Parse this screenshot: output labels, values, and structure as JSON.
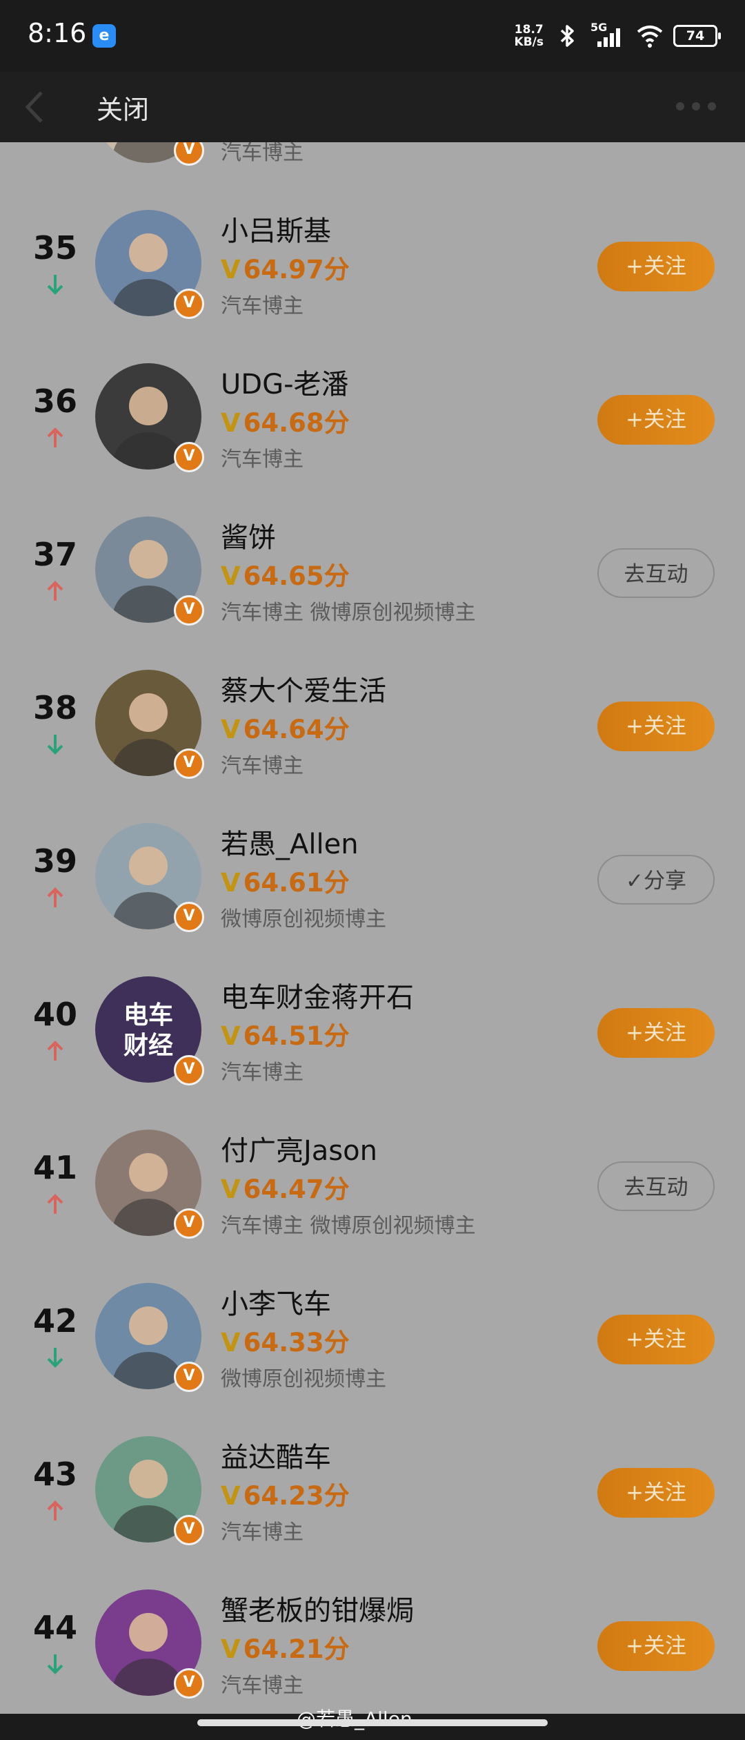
{
  "status_bar": {
    "time": "8:16",
    "app_icon_letter": "e",
    "net_speed_value": "18.7",
    "net_speed_unit": "KB/s",
    "signal_label": "5G",
    "battery": "74"
  },
  "nav": {
    "close_label": "关闭"
  },
  "rows": [
    {
      "rank": "",
      "trend": "up",
      "name": "",
      "score": "",
      "tags": "汽车博主",
      "button": "",
      "button_style": "follow",
      "avatar_color": "#c8b8a6"
    },
    {
      "rank": "35",
      "trend": "down",
      "name": "小吕斯基",
      "score": "64.97分",
      "tags": "汽车博主",
      "button": "+关注",
      "button_style": "follow",
      "avatar_color": "#6e86a6"
    },
    {
      "rank": "36",
      "trend": "up",
      "name": "UDG-老潘",
      "score": "64.68分",
      "tags": "汽车博主",
      "button": "+关注",
      "button_style": "follow",
      "avatar_color": "#3b3b3b"
    },
    {
      "rank": "37",
      "trend": "up",
      "name": "酱饼",
      "score": "64.65分",
      "tags": "汽车博主 微博原创视频博主",
      "button": "去互动",
      "button_style": "outline",
      "avatar_color": "#7a8a98"
    },
    {
      "rank": "38",
      "trend": "down",
      "name": "蔡大个爱生活",
      "score": "64.64分",
      "tags": "汽车博主",
      "button": "+关注",
      "button_style": "follow",
      "avatar_color": "#6a5a3c"
    },
    {
      "rank": "39",
      "trend": "up",
      "name": "若愚_Allen",
      "score": "64.61分",
      "tags": "微博原创视频博主",
      "button": "✓分享",
      "button_style": "outline",
      "avatar_color": "#93a3ad"
    },
    {
      "rank": "40",
      "trend": "up",
      "name": "电车财金蒋开石",
      "score": "64.51分",
      "tags": "汽车博主",
      "button": "+关注",
      "button_style": "follow",
      "avatar_color": "#3e3058",
      "avatar_text": "电车财经"
    },
    {
      "rank": "41",
      "trend": "up",
      "name": "付广亮Jason",
      "score": "64.47分",
      "tags": "汽车博主 微博原创视频博主",
      "button": "去互动",
      "button_style": "outline",
      "avatar_color": "#8a7a72"
    },
    {
      "rank": "42",
      "trend": "down",
      "name": "小李飞车",
      "score": "64.33分",
      "tags": "微博原创视频博主",
      "button": "+关注",
      "button_style": "follow",
      "avatar_color": "#6f8aa4"
    },
    {
      "rank": "43",
      "trend": "up",
      "name": "益达酷车",
      "score": "64.23分",
      "tags": "汽车博主",
      "button": "+关注",
      "button_style": "follow",
      "avatar_color": "#6c9a86"
    },
    {
      "rank": "44",
      "trend": "down",
      "name": "蟹老板的钳爆焗",
      "score": "64.21分",
      "tags": "汽车博主",
      "button": "+关注",
      "button_style": "follow",
      "avatar_color": "#7a3c8c"
    }
  ],
  "score_prefix": "V",
  "watermark": "@若愚_Allen",
  "colors": {
    "trend_up": "#d9645c",
    "trend_down": "#2aa37a",
    "score": "#c76a12",
    "follow_button": "#d88418",
    "verified_badge": "#e17a16"
  }
}
